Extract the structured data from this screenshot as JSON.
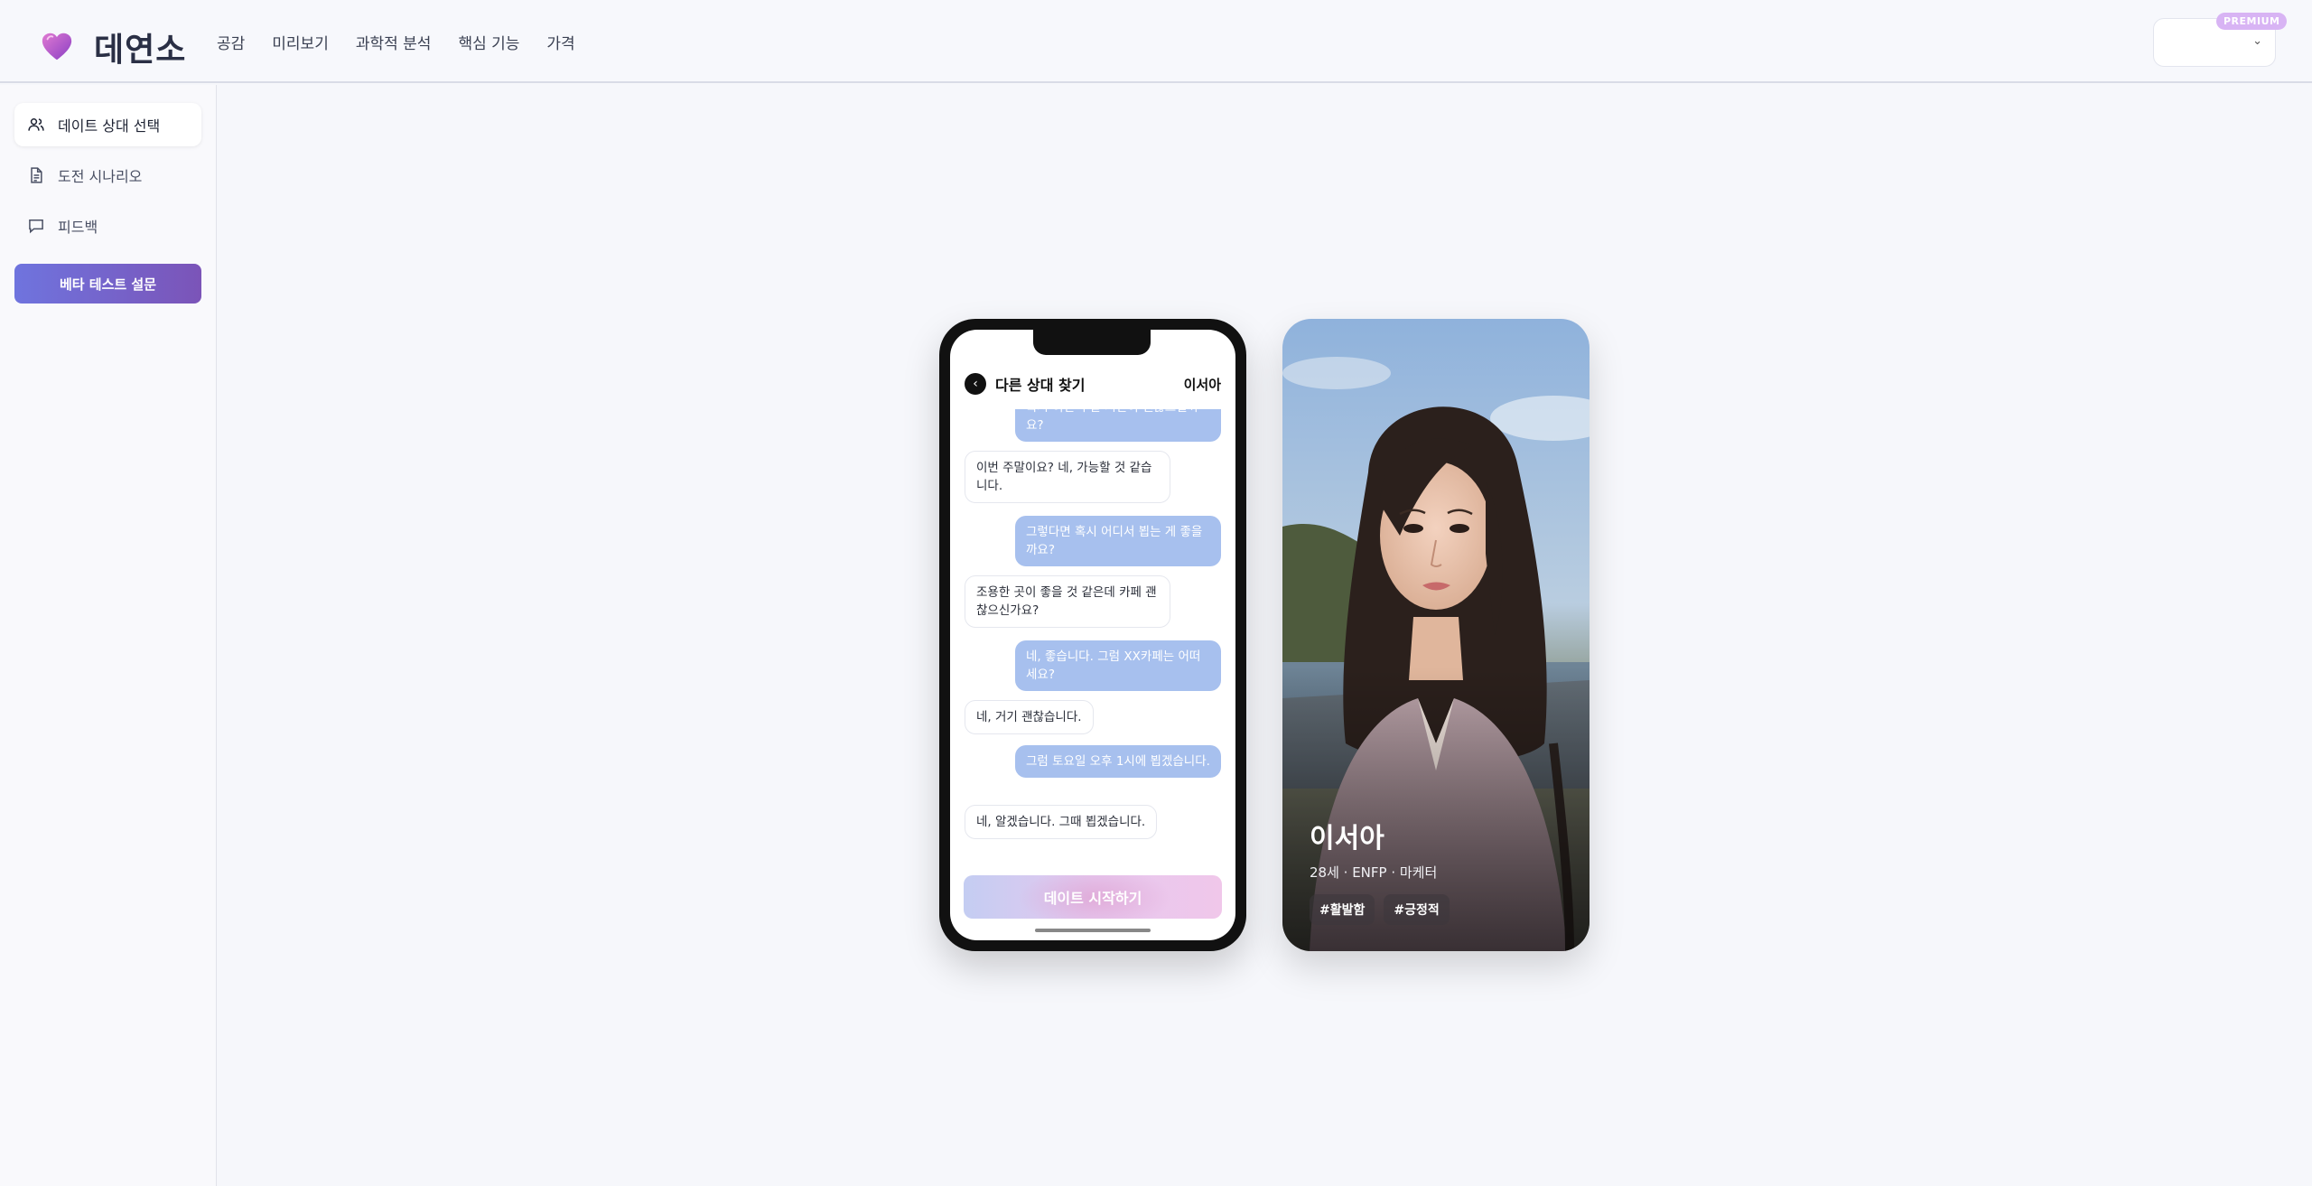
{
  "app": {
    "name": "데연소"
  },
  "nav": {
    "items": [
      "공감",
      "미리보기",
      "과학적 분석",
      "핵심 기능",
      "가격"
    ]
  },
  "account": {
    "badge": "PREMIUM"
  },
  "sidebar": {
    "items": [
      {
        "label": "데이트 상대 선택",
        "icon": "users-icon"
      },
      {
        "label": "도전 시나리오",
        "icon": "document-icon"
      },
      {
        "label": "피드백",
        "icon": "chat-icon"
      }
    ],
    "beta_button": "베타 테스트 설문"
  },
  "chat": {
    "back_label": "다른 상대 찾기",
    "partner_name": "이서아",
    "messages": [
      {
        "from": "me",
        "text": "혹시 이번 주말 시간이 괜찮으실까요?"
      },
      {
        "from": "them",
        "text": "이번 주말이요? 네, 가능할 것 같습니다."
      },
      {
        "from": "me",
        "text": "그렇다면 혹시 어디서 뵙는 게 좋을까요?"
      },
      {
        "from": "them",
        "text": "조용한 곳이 좋을 것 같은데 카페 괜찮으신가요?"
      },
      {
        "from": "me",
        "text": "네, 좋습니다. 그럼 XX카페는 어떠세요?"
      },
      {
        "from": "them",
        "text": "네, 거기 괜찮습니다."
      },
      {
        "from": "me",
        "text": "그럼 토요일 오후 1시에 뵙겠습니다."
      },
      {
        "from": "them",
        "text": "네, 알겠습니다. 그때 뵙겠습니다."
      }
    ],
    "start_button": "데이트 시작하기"
  },
  "profile": {
    "name": "이서아",
    "meta": "28세 · ENFP · 마케터",
    "tags": [
      "#활발함",
      "#긍정적"
    ]
  },
  "colors": {
    "accent_start": "#6f74de",
    "accent_end": "#7b54b8",
    "my_bubble": "#a7c0ee",
    "premium_badge": "#d8b4f4"
  }
}
